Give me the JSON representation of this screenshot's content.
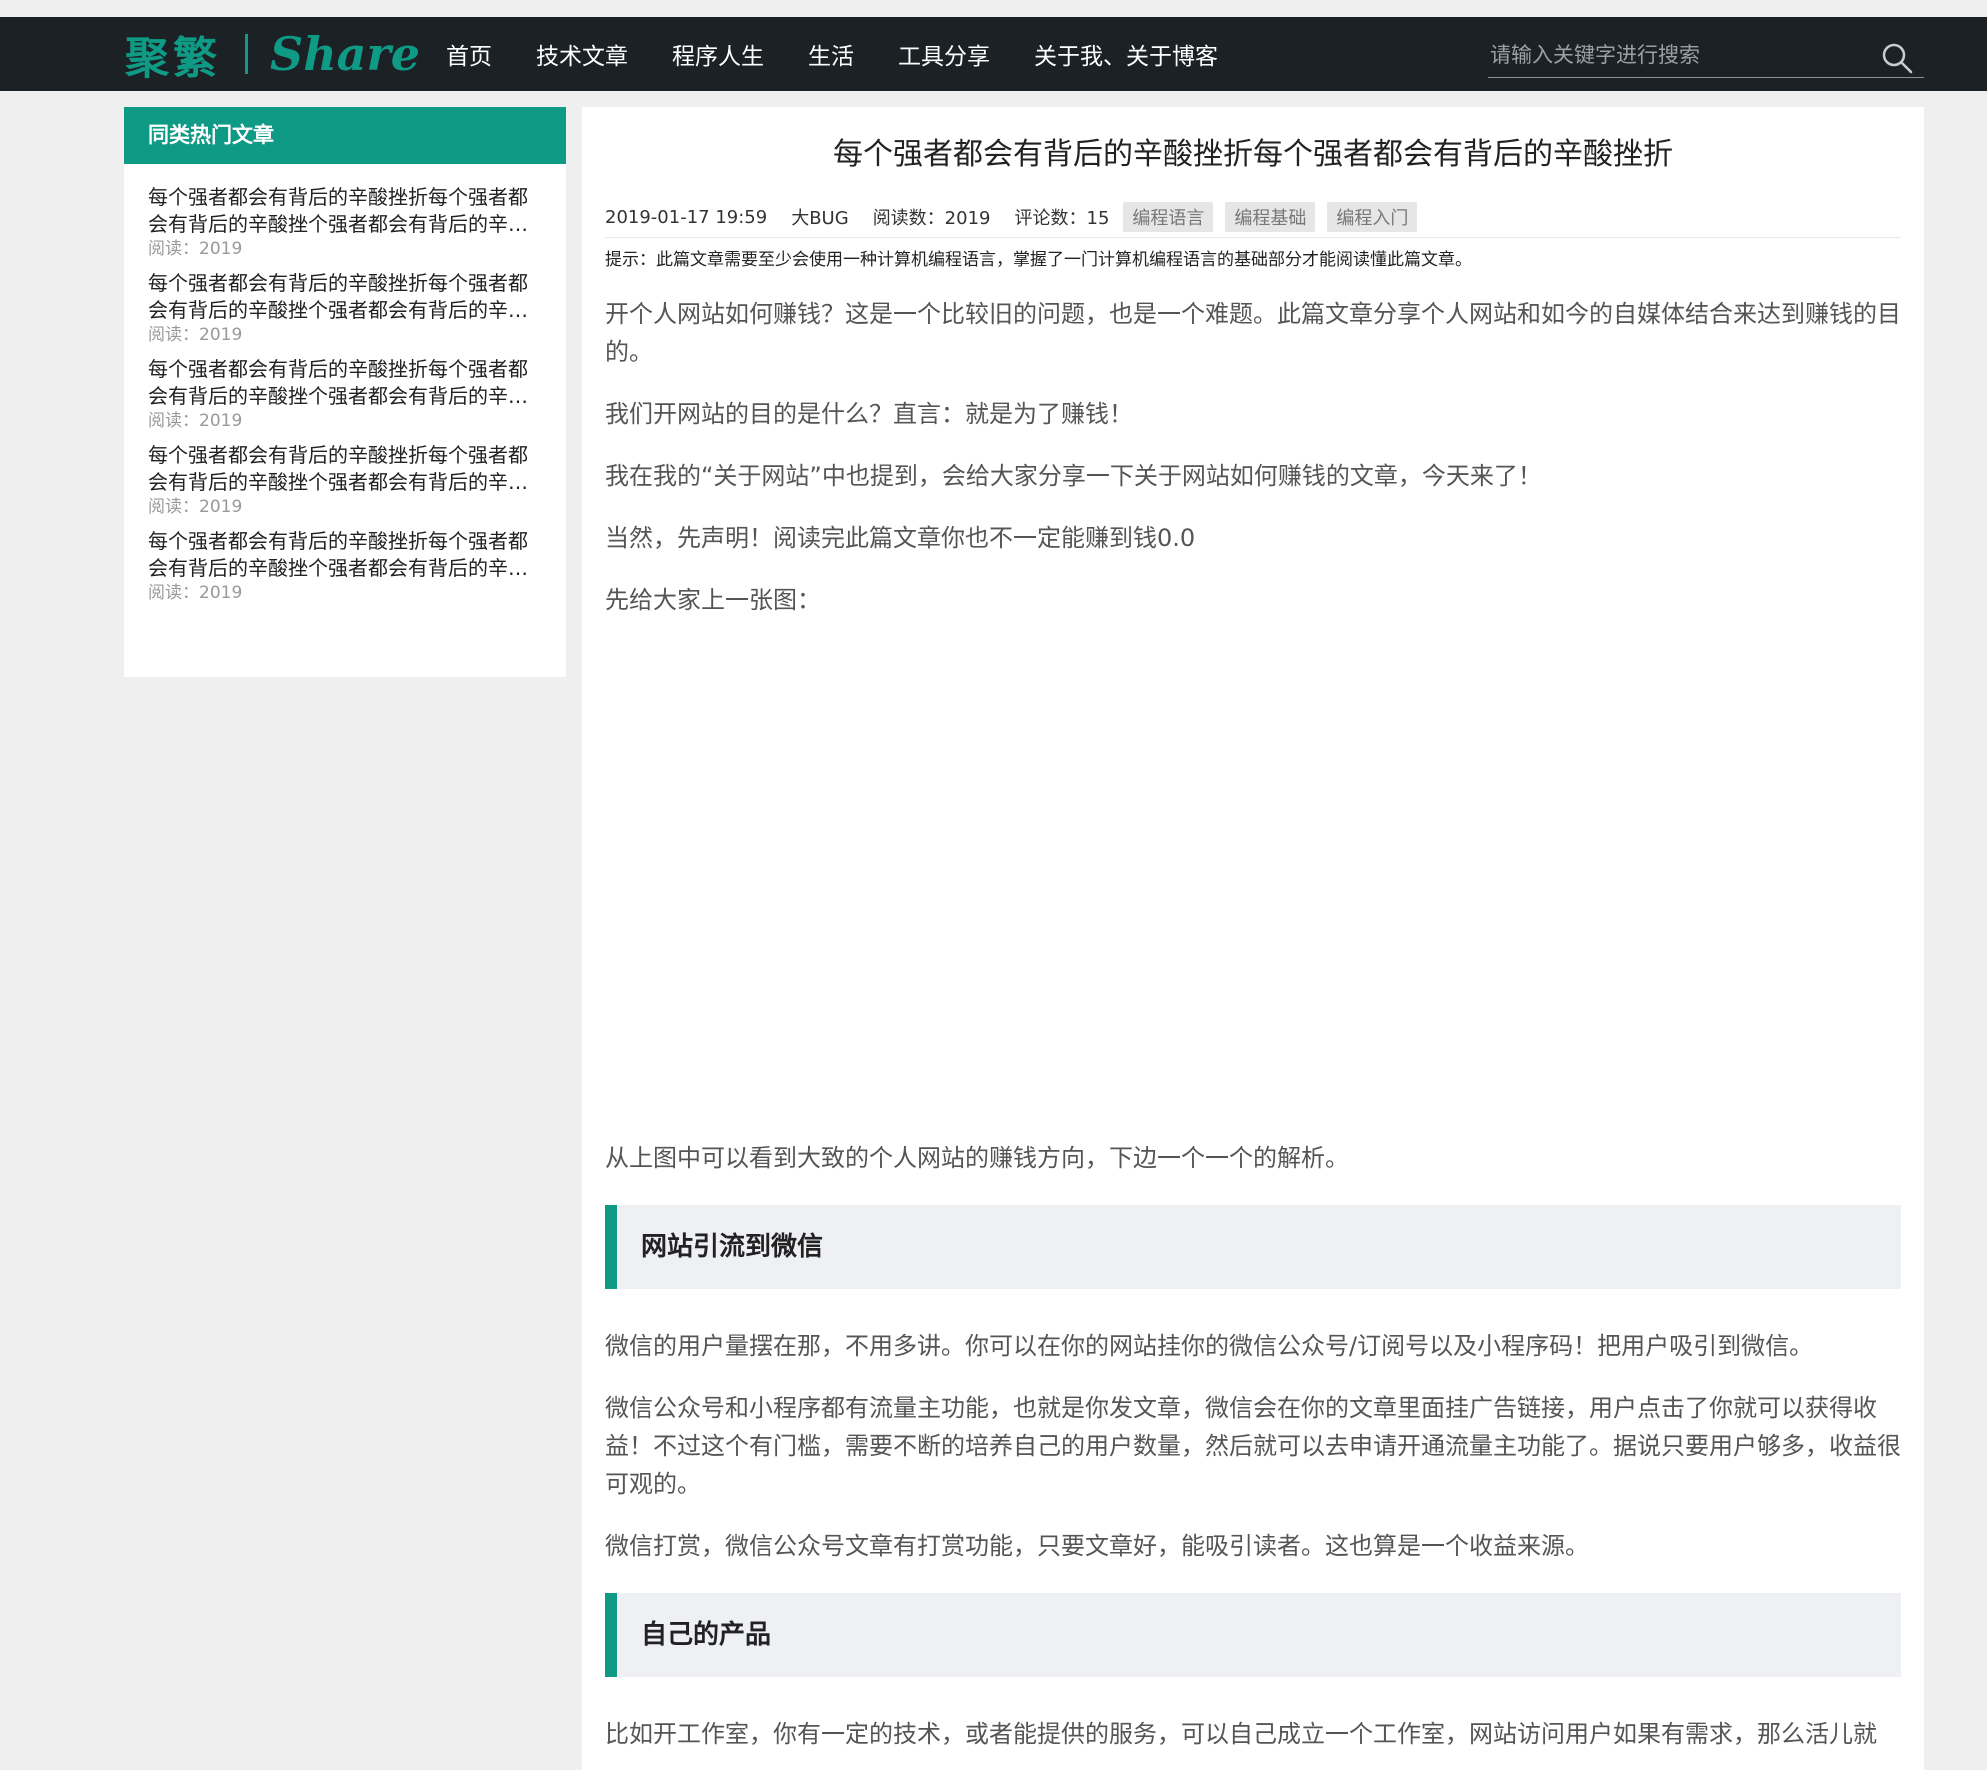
{
  "header": {
    "logo_cn": "聚繁",
    "logo_en": "Share",
    "nav": [
      "首页",
      "技术文章",
      "程序人生",
      "生活",
      "工具分享",
      "关于我、关于博客"
    ],
    "search_placeholder": "请输入关键字进行搜索"
  },
  "sidebar": {
    "title": "同类热门文章",
    "items": [
      {
        "title": "每个强者都会有背后的辛酸挫折每个强者都会有背后的辛酸挫个强者都会有背后的辛酸挫折",
        "read": "阅读：2019"
      },
      {
        "title": "每个强者都会有背后的辛酸挫折每个强者都会有背后的辛酸挫个强者都会有背后的辛酸挫折",
        "read": "阅读：2019"
      },
      {
        "title": "每个强者都会有背后的辛酸挫折每个强者都会有背后的辛酸挫个强者都会有背后的辛酸挫折",
        "read": "阅读：2019"
      },
      {
        "title": "每个强者都会有背后的辛酸挫折每个强者都会有背后的辛酸挫个强者都会有背后的辛酸挫折",
        "read": "阅读：2019"
      },
      {
        "title": "每个强者都会有背后的辛酸挫折每个强者都会有背后的辛酸挫个强者都会有背后的辛酸挫折",
        "read": "阅读：2019"
      }
    ]
  },
  "article": {
    "title": "每个强者都会有背后的辛酸挫折每个强者都会有背后的辛酸挫折",
    "date": "2019-01-17 19:59",
    "author": "大BUG",
    "views": "阅读数：2019",
    "comments": "评论数：15",
    "tags": [
      "编程语言",
      "编程基础",
      "编程入门"
    ],
    "tip": "提示：此篇文章需要至少会使用一种计算机编程语言，掌握了一门计算机编程语言的基础部分才能阅读懂此篇文章。",
    "p1": "开个人网站如何赚钱？这是一个比较旧的问题，也是一个难题。此篇文章分享个人网站和如今的自媒体结合来达到赚钱的目的。",
    "p2": "我们开网站的目的是什么？直言：就是为了赚钱！",
    "p3": "我在我的“关于网站”中也提到，会给大家分享一下关于网站如何赚钱的文章，今天来了！",
    "p4": "当然，先声明！阅读完此篇文章你也不一定能赚到钱0.0",
    "p5": "先给大家上一张图：",
    "p6": "从上图中可以看到大致的个人网站的赚钱方向，下边一个一个的解析。",
    "h_wechat": "网站引流到微信",
    "p7": "微信的用户量摆在那，不用多讲。你可以在你的网站挂你的微信公众号/订阅号以及小程序码！把用户吸引到微信。",
    "p8": "微信公众号和小程序都有流量主功能，也就是你发文章，微信会在你的文章里面挂广告链接，用户点击了你就可以获得收益！不过这个有门槛，需要不断的培养自己的用户数量，然后就可以去申请开通流量主功能了。据说只要用户够多，收益很可观的。",
    "p9": "微信打赏，微信公众号文章有打赏功能，只要文章好，能吸引读者。这也算是一个收益来源。",
    "h_product": "自己的产品",
    "p10": "比如开工作室，你有一定的技术，或者能提供的服务，可以自己成立一个工作室，网站访问用户如果有需求，那么活儿就"
  },
  "colors": {
    "accent": "#0f9a86",
    "header_bg": "#1b2125",
    "page_bg": "#efefef"
  }
}
